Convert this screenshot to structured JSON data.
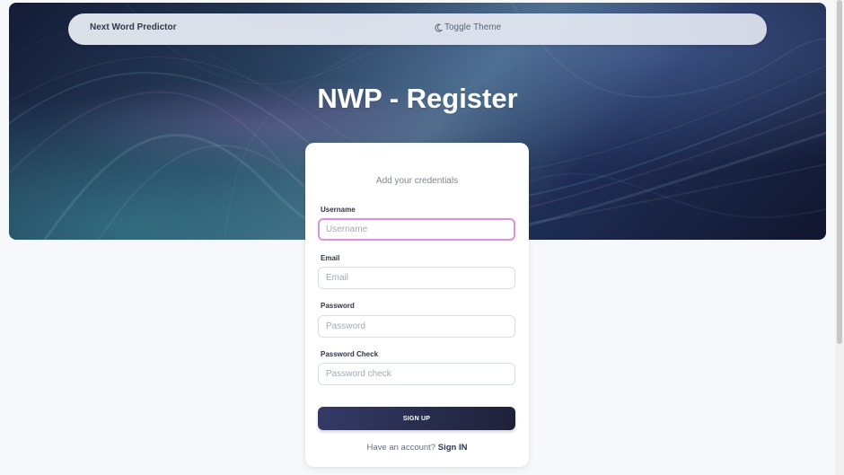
{
  "header": {
    "brand": "Next Word Predictor",
    "toggle_theme": "Toggle Theme",
    "theme_icon": "moon-icon"
  },
  "main": {
    "title": "NWP - Register"
  },
  "form": {
    "subtitle": "Add your credentials",
    "fields": [
      {
        "label": "Username",
        "value": "",
        "placeholder": "Username"
      },
      {
        "label": "Email",
        "value": "",
        "placeholder": "Email"
      },
      {
        "label": "Password",
        "value": "",
        "placeholder": "Password"
      },
      {
        "label": "Password Check",
        "value": "",
        "placeholder": "Password check"
      }
    ],
    "submit_label": "SIGN UP",
    "account_prompt": "Have an account?",
    "signin_label": "Sign IN"
  },
  "colors": {
    "focus_border": "#d995d9",
    "button_start": "#343a66",
    "button_end": "#1e2239",
    "page_background": "#f7f8fa"
  }
}
